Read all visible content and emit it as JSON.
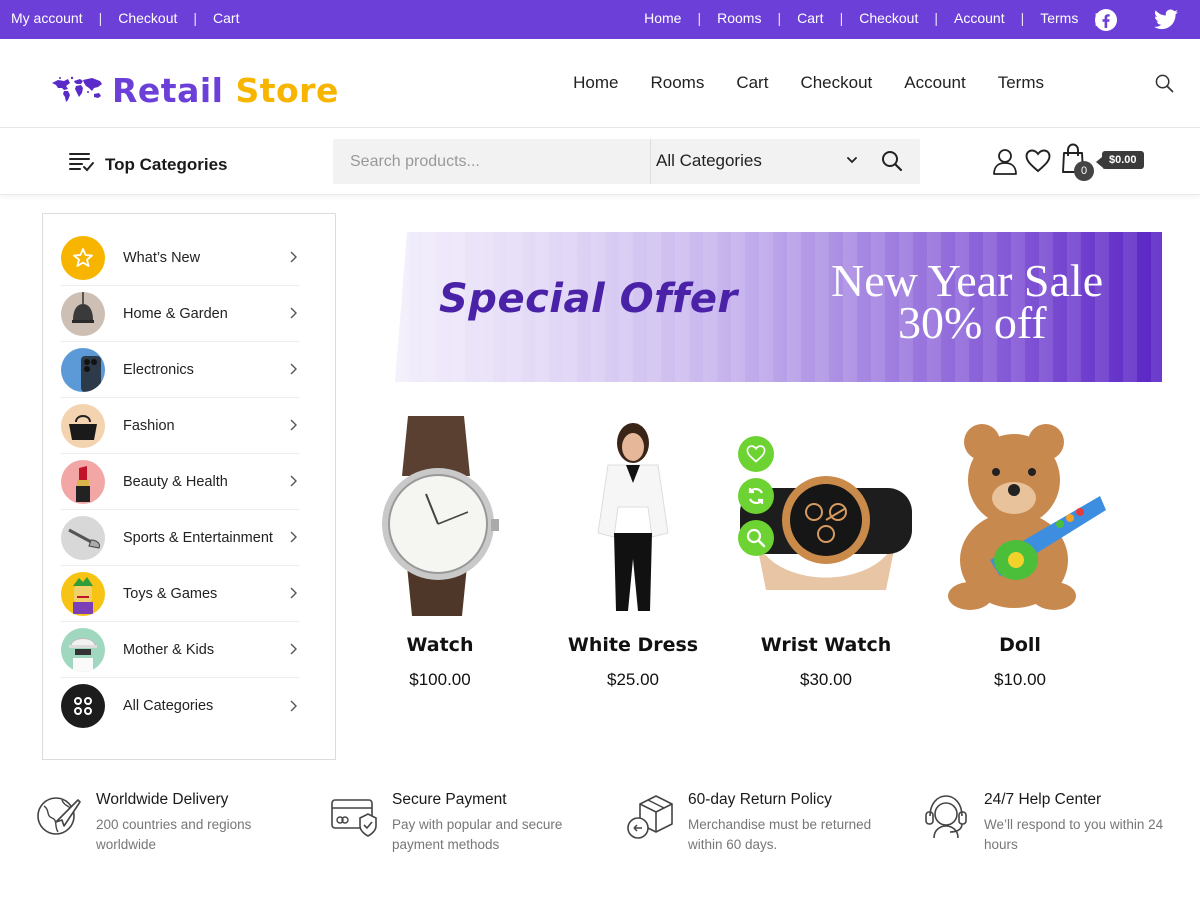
{
  "topbar": {
    "left_links": [
      "My account",
      "Checkout",
      "Cart"
    ],
    "right_links": [
      "Home",
      "Rooms",
      "Cart",
      "Checkout",
      "Account",
      "Terms"
    ],
    "social": [
      "facebook-icon",
      "twitter-icon"
    ],
    "bg_color": "#6b3fd8"
  },
  "header": {
    "logo_word1": "Retail",
    "logo_word2": "Store",
    "nav": [
      "Home",
      "Rooms",
      "Cart",
      "Checkout",
      "Account",
      "Terms"
    ]
  },
  "searchbar": {
    "top_categories_label": "Top Categories",
    "search_placeholder": "Search products...",
    "category_select": "All Categories",
    "cart_count": "0",
    "cart_amount": "$0.00"
  },
  "sidebar": {
    "items": [
      {
        "label": "What’s New"
      },
      {
        "label": "Home & Garden"
      },
      {
        "label": "Electronics"
      },
      {
        "label": "Fashion"
      },
      {
        "label": "Beauty & Health"
      },
      {
        "label": "Sports & Entertainment"
      },
      {
        "label": "Toys & Games"
      },
      {
        "label": "Mother & Kids"
      },
      {
        "label": "All Categories"
      }
    ]
  },
  "banner": {
    "special": "Special Offer",
    "sale_line1": "New Year Sale",
    "sale_line2": "30% off"
  },
  "products": [
    {
      "name": "Watch",
      "price": "$100.00"
    },
    {
      "name": "White Dress",
      "price": "$25.00"
    },
    {
      "name": "Wrist Watch",
      "price": "$30.00"
    },
    {
      "name": "Doll",
      "price": "$10.00"
    }
  ],
  "features": [
    {
      "title": "Worldwide Delivery",
      "desc": "200 countries and regions worldwide"
    },
    {
      "title": "Secure Payment",
      "desc": "Pay with popular and secure payment methods"
    },
    {
      "title": "60-day Return Policy",
      "desc": "Merchandise must be returned within 60 days."
    },
    {
      "title": "24/7 Help Center",
      "desc": "We’ll respond to you within 24 hours"
    }
  ]
}
